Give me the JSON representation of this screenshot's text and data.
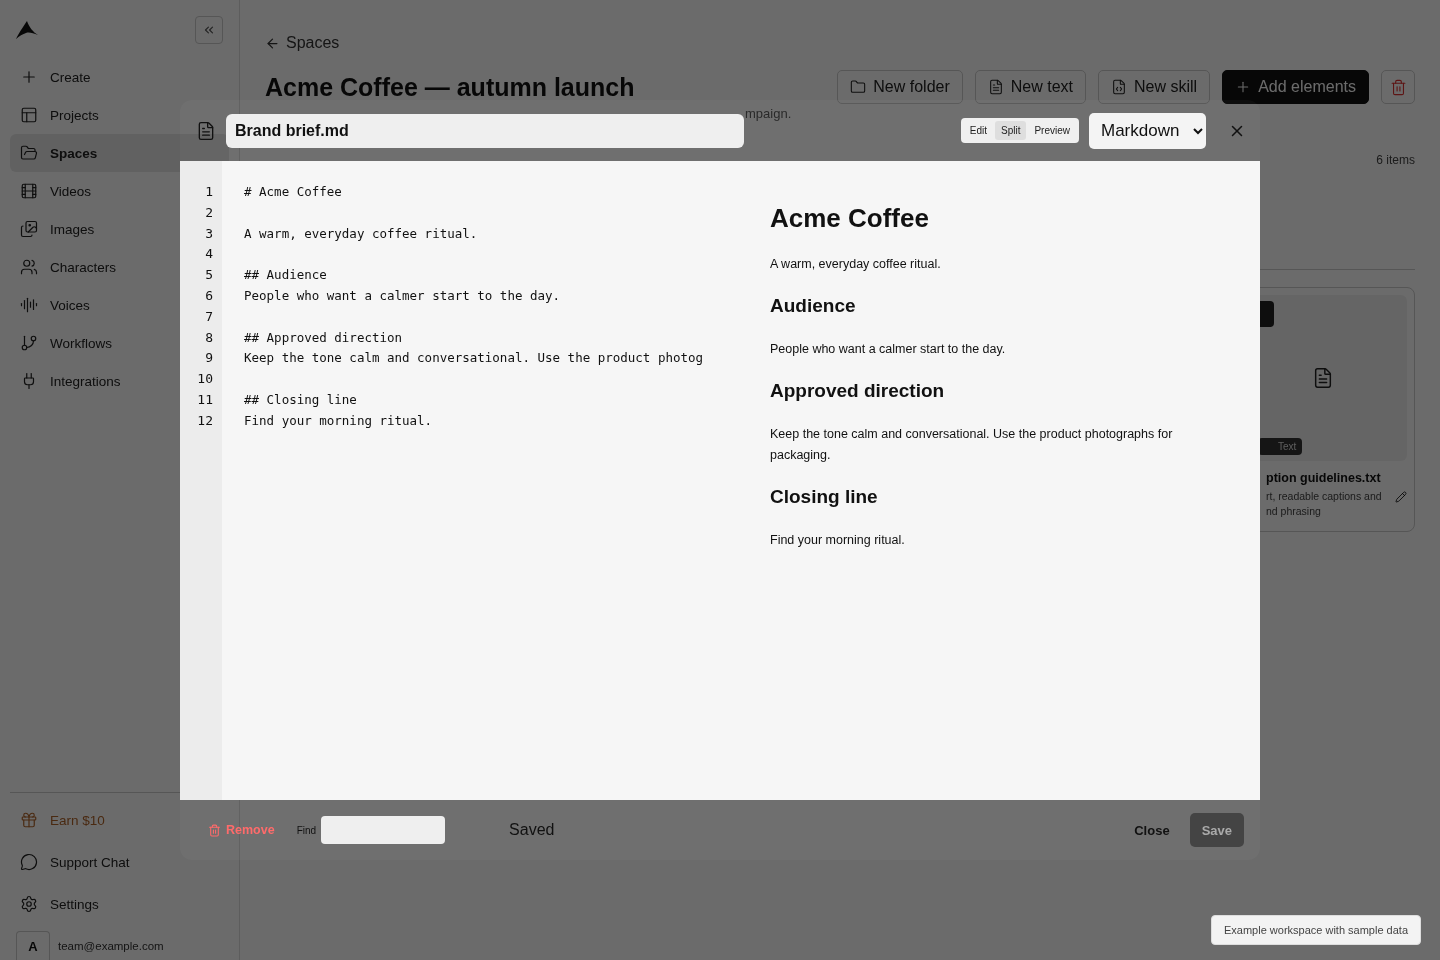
{
  "sidebar": {
    "items": [
      {
        "label": "Create",
        "selected": false
      },
      {
        "label": "Projects",
        "selected": false
      },
      {
        "label": "Spaces",
        "selected": true
      },
      {
        "label": "Videos",
        "selected": false
      },
      {
        "label": "Images",
        "selected": false
      },
      {
        "label": "Characters",
        "selected": false
      },
      {
        "label": "Voices",
        "selected": false
      },
      {
        "label": "Workflows",
        "selected": false
      },
      {
        "label": "Integrations",
        "selected": false
      }
    ],
    "footer_items": [
      {
        "label": "Earn $10",
        "kind": "promo"
      },
      {
        "label": "Support Chat",
        "kind": "plain"
      },
      {
        "label": "Settings",
        "kind": "plain"
      }
    ],
    "account": {
      "avatar": "A",
      "email": "team@example.com"
    }
  },
  "page": {
    "back_link": "Spaces",
    "title": "Acme Coffee — autumn launch",
    "subtitle": "mpaign.",
    "actions": [
      {
        "label": "New folder",
        "kind": "outline"
      },
      {
        "label": "New text",
        "kind": "outline"
      },
      {
        "label": "New skill",
        "kind": "outline"
      },
      {
        "label": "Add elements",
        "kind": "primary"
      }
    ],
    "item_count": "6 items",
    "card": {
      "badge": "Text",
      "title": "ption guidelines.txt",
      "description_lines": [
        "rt, readable captions and",
        "nd phrasing"
      ]
    }
  },
  "editor": {
    "filename": "Brand brief.md",
    "modes": [
      {
        "label": "Edit",
        "selected": false
      },
      {
        "label": "Split",
        "selected": true
      },
      {
        "label": "Preview",
        "selected": false
      }
    ],
    "format": "Markdown",
    "lines": [
      {
        "number": "1",
        "text": "# Acme Coffee"
      },
      {
        "number": "2"
      },
      {
        "number": "3",
        "text": "A warm, everyday coffee ritual."
      },
      {
        "number": "4"
      },
      {
        "number": "5",
        "text": "## Audience"
      },
      {
        "number": "6",
        "text": "People who want a calmer start to the day."
      },
      {
        "number": "7"
      },
      {
        "number": "8",
        "text": "## Approved direction"
      },
      {
        "number": "9",
        "text": "Keep the tone calm and conversational. Use the product photog"
      },
      {
        "number": "10"
      },
      {
        "number": "11",
        "text": "## Closing line"
      },
      {
        "number": "12",
        "text": "Find your morning ritual."
      }
    ],
    "preview": [
      {
        "kind": "h1",
        "text": "Acme Coffee"
      },
      {
        "kind": "p",
        "text": "A warm, everyday coffee ritual."
      },
      {
        "kind": "h2",
        "text": "Audience"
      },
      {
        "kind": "p",
        "text": "People who want a calmer start to the day."
      },
      {
        "kind": "h2",
        "text": "Approved direction"
      },
      {
        "kind": "p",
        "text": "Keep the tone calm and conversational. Use the product photographs for packaging."
      },
      {
        "kind": "h2",
        "text": "Closing line"
      },
      {
        "kind": "p",
        "text": "Find your morning ritual."
      }
    ],
    "footer": {
      "remove": "Remove",
      "find_label": "Find",
      "status": "Saved",
      "close": "Close",
      "save": "Save",
      "save_disabled": true
    }
  },
  "toast": "Example workspace with sample data"
}
